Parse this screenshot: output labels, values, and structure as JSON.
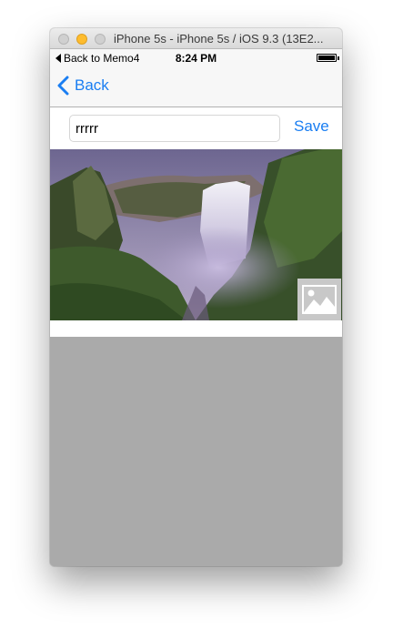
{
  "window": {
    "title": "iPhone 5s - iPhone 5s / iOS 9.3 (13E2..."
  },
  "statusbar": {
    "back_app_label": "Back to Memo4",
    "time": "8:24 PM"
  },
  "navbar": {
    "back_label": "Back"
  },
  "memo": {
    "value": "rrrrr",
    "save_label": "Save"
  },
  "colors": {
    "accent": "#1a7ef2",
    "bottom_area": "#aaaaaa",
    "navbar_bg": "#f7f7f7",
    "minimize_button": "#febc2e"
  },
  "icons": {
    "back": "chevron-left-icon",
    "status_back": "triangle-left-icon",
    "battery": "battery-icon",
    "photo_placeholder": "image-placeholder-icon"
  }
}
